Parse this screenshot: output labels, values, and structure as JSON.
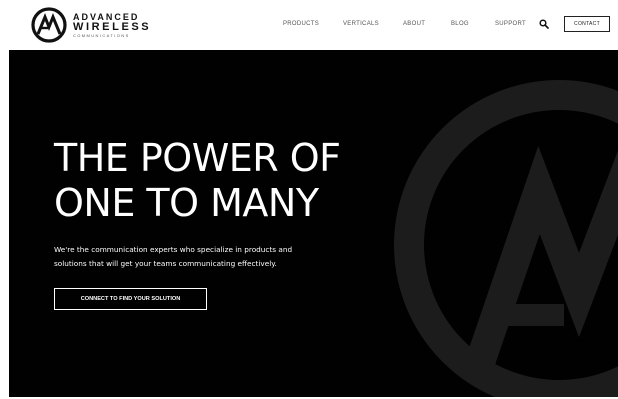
{
  "header": {
    "logo": {
      "line1": "ADVANCED",
      "line2": "WIRELESS",
      "line3": "COMMUNICATIONS"
    },
    "nav": [
      "PRODUCTS",
      "VERTICALS",
      "ABOUT",
      "BLOG",
      "SUPPORT"
    ],
    "search_icon": "search-icon",
    "contact_label": "CONTACT"
  },
  "hero": {
    "title_line1": "THE POWER OF",
    "title_line2": "ONE TO MANY",
    "description_line1": "We're the communication experts who specialize in products and",
    "description_line2": "solutions that will get your teams communicating effectively.",
    "cta_label": "CONNECT TO FIND YOUR SOLUTION"
  },
  "colors": {
    "hero_background": "#010101",
    "hero_watermark": "#1c1c1c",
    "text_dark": "#111111",
    "text_light": "#ffffff"
  }
}
